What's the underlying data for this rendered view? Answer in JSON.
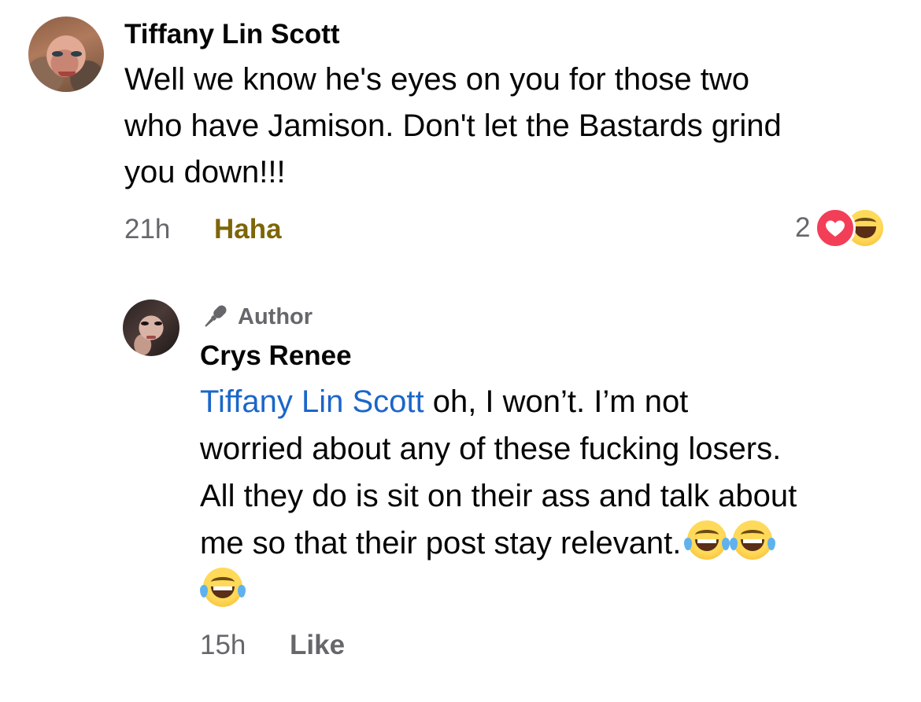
{
  "comments": [
    {
      "author": "Tiffany Lin Scott",
      "text_lines": [
        "Well we know he's eyes on you for those two",
        "who have Jamison. Don't let the Bastards grind",
        "you down!!!"
      ],
      "time": "21h",
      "action": "Haha",
      "reaction_count": "2",
      "reaction_icons": [
        "love-icon",
        "haha-icon"
      ],
      "action_color": "#7d6608"
    },
    {
      "badge": "Author",
      "badge_icon": "microphone-icon",
      "author": "Crys Renee",
      "mention": "Tiffany Lin Scott",
      "text_lines": [
        " oh, I won’t. I’m not",
        "worried about any of these fucking losers.",
        "All they do is sit on their ass and talk about",
        "me so that their post stay relevant."
      ],
      "emoji_icon": "tears-of-joy-emoji",
      "emoji_count": 3,
      "time": "15h",
      "action": "Like",
      "mention_color": "#1b66c9"
    }
  ]
}
